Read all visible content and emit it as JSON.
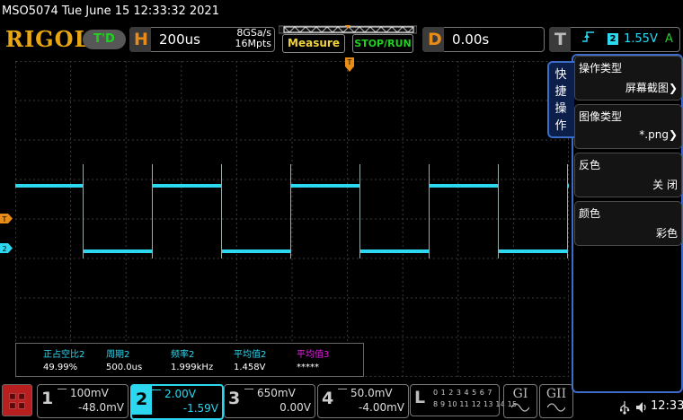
{
  "status_bar": {
    "text": "MSO5074  Tue June 15 12:33:32 2021"
  },
  "header": {
    "logo": "RIGOL",
    "trigger_state": "T'D",
    "horizontal": {
      "key": "H",
      "timebase": "200us",
      "sample_rate": "8GSa/s",
      "memory_depth": "16Mpts"
    },
    "measure_label": "Measure",
    "stoprun_label": "STOP/RUN",
    "delay": {
      "key": "D",
      "value": "0.00s"
    },
    "trigger": {
      "key": "T",
      "edge_icon": "rising-edge-icon",
      "source": "2",
      "level": "1.55V",
      "mode": "A"
    }
  },
  "waveform": {
    "channel_color": "#2cd7f0",
    "trigger_marker_color": "#e88c18",
    "trigger_level_marker": "T",
    "channel_marker": "2",
    "signal": {
      "high_level": "3.2V",
      "low_level": "-0.3V",
      "period": "500.0us",
      "duty_cycle": "49.99%"
    }
  },
  "measurements": [
    {
      "label": "正占空比2",
      "value": "49.99%",
      "color": "#2cd7f0"
    },
    {
      "label": "周期2",
      "value": "500.0us",
      "color": "#2cd7f0"
    },
    {
      "label": "频率2",
      "value": "1.999kHz",
      "color": "#2cd7f0"
    },
    {
      "label": "平均值2",
      "value": "1.458V",
      "color": "#2cd7f0"
    },
    {
      "label": "平均值3",
      "value": "*****",
      "color": "#e020e0"
    }
  ],
  "side_menu": {
    "tab_label": "快捷操作",
    "items": [
      {
        "label": "操作类型",
        "value": "屏幕截图",
        "has_arrow": true
      },
      {
        "label": "图像类型",
        "value": "*.png",
        "has_arrow": true
      },
      {
        "label": "反色",
        "value": "关 闭",
        "has_arrow": false
      },
      {
        "label": "颜色",
        "value": "彩色",
        "has_arrow": false
      }
    ]
  },
  "channels": [
    {
      "num": "1",
      "scale": "100mV",
      "offset": "-48.0mV",
      "active": false
    },
    {
      "num": "2",
      "scale": "2.00V",
      "offset": "-1.59V",
      "active": true
    },
    {
      "num": "3",
      "scale": "650mV",
      "offset": "0.00V",
      "active": false
    },
    {
      "num": "4",
      "scale": "50.0mV",
      "offset": "-4.00mV",
      "active": false
    }
  ],
  "logic_analyzer": {
    "key": "L",
    "row1": "0 1 2 3  4 5 6 7",
    "row2": "8 9 10 11 12 13 14 15"
  },
  "generators": [
    "GI",
    "GII"
  ],
  "system_tray": {
    "usb_icon": "usb-icon",
    "speaker_icon": "speaker-icon",
    "time": "12:33"
  }
}
